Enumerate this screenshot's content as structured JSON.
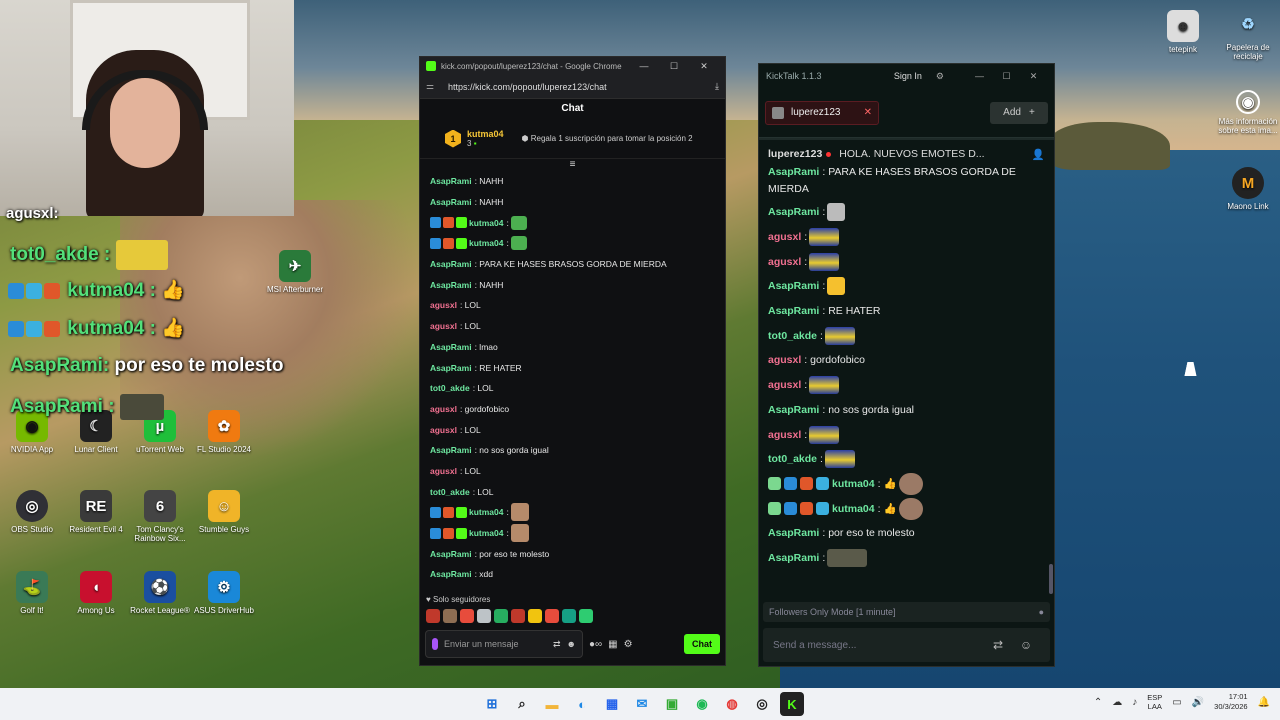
{
  "colors": {
    "kick_green": "#53fc18",
    "user_green": "#6ee7a0",
    "user_pink": "#f07090",
    "gold": "#f5c637"
  },
  "overlay": {
    "lines": [
      {
        "user": "agusxl",
        "sep": ":",
        "text": ""
      },
      {
        "user": "tot0_akde",
        "sep": ":",
        "text": ""
      },
      {
        "user": "kutma04",
        "sep": ":",
        "text": ""
      },
      {
        "user": "kutma04",
        "sep": ":",
        "text": ""
      },
      {
        "user": "AsapRami",
        "sep": ":",
        "text": "por eso te molesto"
      },
      {
        "user": "AsapRami",
        "sep": ":",
        "text": ""
      }
    ]
  },
  "desktop_icons": [
    {
      "label": "NVIDIA App",
      "icon": "nvidia-icon"
    },
    {
      "label": "Lunar Client",
      "icon": "lunar-client-icon"
    },
    {
      "label": "uTorrent Web",
      "icon": "utorrent-icon"
    },
    {
      "label": "FL Studio 2024",
      "icon": "fl-studio-icon"
    },
    {
      "label": "OBS Studio",
      "icon": "obs-icon"
    },
    {
      "label": "Resident Evil 4",
      "icon": "re4-icon"
    },
    {
      "label": "Tom Clancy's Rainbow Six...",
      "icon": "r6-icon"
    },
    {
      "label": "Stumble Guys",
      "icon": "stumble-guys-icon"
    },
    {
      "label": "Golf It!",
      "icon": "golf-it-icon"
    },
    {
      "label": "Among Us",
      "icon": "among-us-icon"
    },
    {
      "label": "Rocket League®",
      "icon": "rocket-league-icon"
    },
    {
      "label": "ASUS DriverHub",
      "icon": "asus-driverhub-icon"
    },
    {
      "label": "MSI Afterburner",
      "icon": "msi-afterburner-icon"
    },
    {
      "label": "tetepink",
      "icon": "tetepink-icon"
    },
    {
      "label": "Papelera de reciclaje",
      "icon": "recycle-bin-icon"
    },
    {
      "label": "Más información sobre esta ima...",
      "icon": "info-camera-icon"
    },
    {
      "label": "Maono Link",
      "icon": "maono-link-icon"
    }
  ],
  "chrome": {
    "title": "kick.com/popout/luperez123/chat - Google Chrome",
    "url": "https://kick.com/popout/luperez123/chat",
    "chat_header": "Chat",
    "pinned": {
      "rank": "1",
      "name": "kutma04",
      "count": "3",
      "gift_text": "Regala 1 suscripción para tomar la posición 2"
    },
    "messages": [
      {
        "user": "AsapRami",
        "text": ": NAHH",
        "color": "green"
      },
      {
        "user": "AsapRami",
        "text": ": NAHH",
        "color": "green"
      },
      {
        "user": "kutma04",
        "text": ":",
        "color": "green"
      },
      {
        "user": "kutma04",
        "text": ":",
        "color": "green"
      },
      {
        "user": "AsapRami",
        "text": ": PARA KE HASES BRASOS GORDA DE MIERDA",
        "color": "green"
      },
      {
        "user": "AsapRami",
        "text": ": NAHH",
        "color": "green"
      },
      {
        "user": "agusxl",
        "text": ": LOL",
        "color": "pink"
      },
      {
        "user": "agusxl",
        "text": ": LOL",
        "color": "pink"
      },
      {
        "user": "AsapRami",
        "text": ": lmao",
        "color": "green"
      },
      {
        "user": "AsapRami",
        "text": ": RE HATER",
        "color": "green"
      },
      {
        "user": "tot0_akde",
        "text": ": LOL",
        "color": "green"
      },
      {
        "user": "agusxl",
        "text": ": gordofobico",
        "color": "pink"
      },
      {
        "user": "agusxl",
        "text": ": LOL",
        "color": "pink"
      },
      {
        "user": "AsapRami",
        "text": ": no sos gorda igual",
        "color": "green"
      },
      {
        "user": "agusxl",
        "text": ": LOL",
        "color": "pink"
      },
      {
        "user": "tot0_akde",
        "text": ": LOL",
        "color": "green"
      },
      {
        "user": "kutma04",
        "text": ":",
        "color": "green"
      },
      {
        "user": "kutma04",
        "text": ":",
        "color": "green"
      },
      {
        "user": "AsapRami",
        "text": ": por eso te molesto",
        "color": "green"
      },
      {
        "user": "AsapRami",
        "text": ": xdd",
        "color": "green"
      }
    ],
    "followers_only": "Solo seguidores",
    "input_placeholder": "Enviar un mensaje",
    "send_label": "Chat"
  },
  "kicktalk": {
    "title": "KickTalk 1.1.3",
    "sign_in": "Sign In",
    "tab_label": "luperez123",
    "add_label": "Add",
    "stream_user": "luperez123",
    "stream_title": "HOLA. NUEVOS EMOTES D...",
    "messages": [
      {
        "user": "AsapRami",
        "text": ": PARA KE HASES BRASOS GORDA DE MIERDA",
        "color": "green",
        "emote": false
      },
      {
        "user": "AsapRami",
        "text": ":",
        "color": "green",
        "emote": true
      },
      {
        "user": "agusxl",
        "text": ":",
        "color": "pink",
        "emote": true
      },
      {
        "user": "agusxl",
        "text": ":",
        "color": "pink",
        "emote": true
      },
      {
        "user": "AsapRami",
        "text": ":",
        "color": "green",
        "emote": true
      },
      {
        "user": "AsapRami",
        "text": ": RE HATER",
        "color": "green",
        "emote": false
      },
      {
        "user": "tot0_akde",
        "text": ":",
        "color": "green",
        "emote": true
      },
      {
        "user": "agusxl",
        "text": ": gordofobico",
        "color": "pink",
        "emote": false
      },
      {
        "user": "agusxl",
        "text": ":",
        "color": "pink",
        "emote": true
      },
      {
        "user": "AsapRami",
        "text": ": no sos gorda igual",
        "color": "green",
        "emote": false
      },
      {
        "user": "agusxl",
        "text": ":",
        "color": "pink",
        "emote": true
      },
      {
        "user": "tot0_akde",
        "text": ":",
        "color": "green",
        "emote": true
      },
      {
        "user": "kutma04",
        "text": ":",
        "color": "green",
        "emote": true
      },
      {
        "user": "kutma04",
        "text": ":",
        "color": "green",
        "emote": true
      },
      {
        "user": "AsapRami",
        "text": ": por eso te molesto",
        "color": "green",
        "emote": false
      },
      {
        "user": "AsapRami",
        "text": ":",
        "color": "green",
        "emote": true
      }
    ],
    "followers_mode": "Followers Only Mode [1 minute]",
    "send_placeholder": "Send a message..."
  },
  "taskbar": {
    "lang_top": "ESP",
    "lang_bottom": "LAA",
    "time": "17:01",
    "date": "30/3/2026"
  }
}
